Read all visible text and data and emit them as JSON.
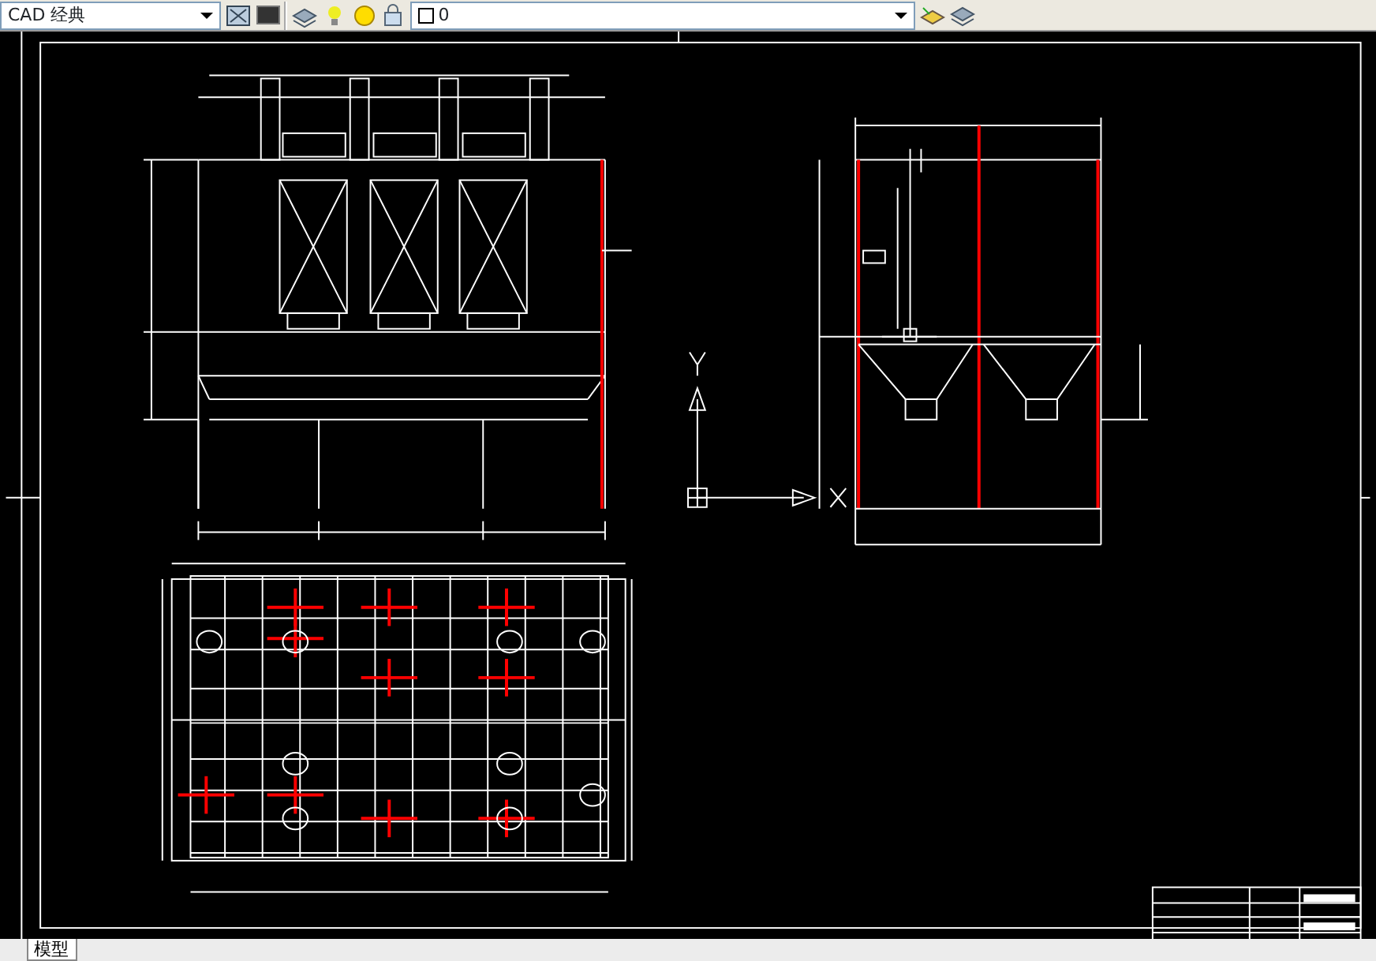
{
  "toolbar": {
    "workspace": "CAD 经典",
    "layer": "0"
  },
  "tabs": [
    {
      "label": "模型",
      "selected": true
    }
  ]
}
